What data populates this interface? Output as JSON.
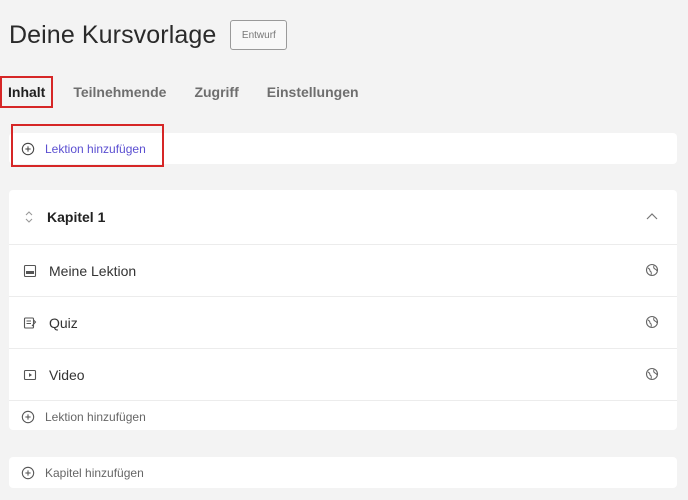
{
  "header": {
    "title": "Deine Kursvorlage",
    "status_badge": "Entwurf"
  },
  "tabs": [
    {
      "label": "Inhalt",
      "active": true
    },
    {
      "label": "Teilnehmende",
      "active": false
    },
    {
      "label": "Zugriff",
      "active": false
    },
    {
      "label": "Einstellungen",
      "active": false
    }
  ],
  "add_lesson_top": {
    "label": "Lektion hinzufügen",
    "icon": "plus-circle-icon"
  },
  "chapter": {
    "title": "Kapitel 1",
    "lessons": [
      {
        "label": "Meine Lektion",
        "type_icon": "pdf-icon"
      },
      {
        "label": "Quiz",
        "type_icon": "quiz-icon"
      },
      {
        "label": "Video",
        "type_icon": "video-icon"
      }
    ],
    "add_lesson_label": "Lektion hinzufügen"
  },
  "add_chapter": {
    "label": "Kapitel hinzufügen"
  },
  "colors": {
    "accent": "#5b4fd1",
    "highlight": "#d62626",
    "background": "#f3f3f3"
  }
}
